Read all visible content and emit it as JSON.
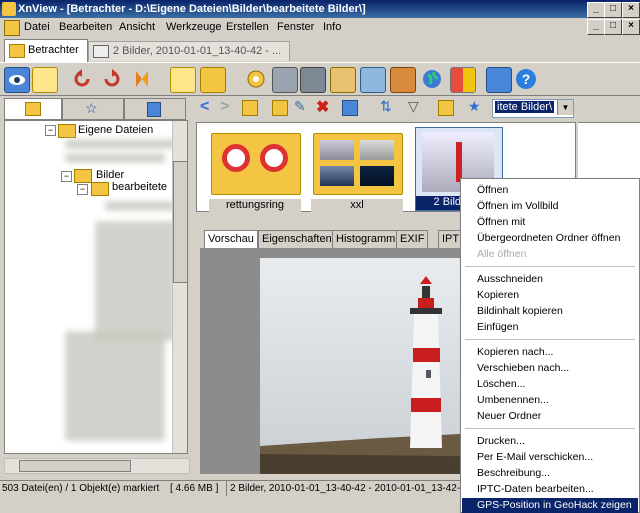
{
  "window": {
    "title": "XnView - [Betrachter - D:\\Eigene Dateien\\Bilder\\bearbeitete Bilder\\]"
  },
  "menu": [
    "Datei",
    "Bearbeiten",
    "Ansicht",
    "Werkzeuge",
    "Erstellen",
    "Fenster",
    "Info"
  ],
  "tabs": [
    {
      "label": "Betrachter"
    },
    {
      "label": "2 Bilder, 2010-01-01_13-40-42 - ..."
    }
  ],
  "toolbar": {
    "icons": [
      "eye-icon",
      "browser-icon",
      "rotate-left-icon",
      "rotate-right-icon",
      "flip-icon",
      "folder-check-icon",
      "folder-open-icon",
      "settings-icon",
      "print-icon",
      "scanner-icon",
      "export-icon",
      "camera-icon",
      "filmstrip-icon",
      "globe-icon",
      "grid-icon",
      "book-icon",
      "help-icon"
    ]
  },
  "tree": {
    "items": [
      {
        "label": "Eigene Dateien"
      },
      {
        "label": "Bilder"
      },
      {
        "label": "bearbeitete"
      }
    ]
  },
  "navbar": {
    "path_value": "itete Bilder\\"
  },
  "thumbs": [
    {
      "label": "rettungsring"
    },
    {
      "label": "xxl"
    },
    {
      "label": "2 Bilder, 2"
    }
  ],
  "preview_tabs": [
    "Vorschau",
    "Eigenschaften",
    "Histogramm",
    "EXIF",
    "IPT"
  ],
  "status": {
    "left": "503 Datei(en) / 1 Objekt(e) markiert",
    "size": "[ 4.66 MB ]",
    "right": "2 Bilder, 2010-01-01_13-40-42 - 2010-01-01_13-42-"
  },
  "context_menu": {
    "groups": [
      [
        "Öffnen",
        "Öffnen im Vollbild",
        "Öffnen mit",
        "Übergeordneten Ordner öffnen",
        "Alle öffnen"
      ],
      [
        "Ausschneiden",
        "Kopieren",
        "Bildinhalt kopieren",
        "Einfügen"
      ],
      [
        "Kopieren nach...",
        "Verschieben nach...",
        "Löschen...",
        "Umbenennen...",
        "Neuer Ordner"
      ],
      [
        "Drucken...",
        "Per E-Mail verschicken...",
        "Beschreibung...",
        "IPTC-Daten bearbeiten...",
        "GPS-Position in GeoHack zeigen"
      ]
    ],
    "disabled_item": "Alle öffnen",
    "highlighted_item": "GPS-Position in GeoHack zeigen"
  },
  "colors": {
    "titlebar": "#0a246a",
    "highlight": "#0a246a",
    "face": "#d4d0c8"
  }
}
